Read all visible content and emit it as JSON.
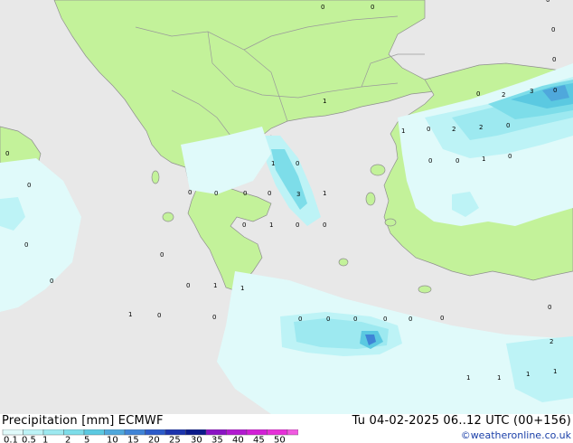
{
  "map": {
    "precip_numbers": [
      "0",
      "0",
      "0",
      "2",
      "3",
      "0",
      "0",
      "1",
      "0",
      "2",
      "2",
      "0",
      "0",
      "0",
      "1",
      "0",
      "0",
      "1",
      "0",
      "0",
      "1",
      "3",
      "0",
      "1",
      "0",
      "0",
      "0",
      "0",
      "0",
      "0",
      "1",
      "0",
      "0",
      "1",
      "1",
      "1",
      "0",
      "0",
      "0",
      "0",
      "0",
      "0",
      "2",
      "0",
      "1",
      "1",
      "1",
      "1",
      "0",
      "0",
      "0",
      "0",
      "0",
      "0"
    ]
  },
  "footer": {
    "title": "Precipitation [mm] ECMWF",
    "valid": "Tu 04-02-2025 06..12 UTC (00+156)",
    "credit": "©weatheronline.co.uk"
  },
  "legend": {
    "labels": [
      "0.1",
      "0.5",
      "1",
      "2",
      "5",
      "10",
      "15",
      "20",
      "25",
      "30",
      "35",
      "40",
      "45",
      "50"
    ],
    "colors": [
      "#e0fafa",
      "#bdf3f6",
      "#9de9f0",
      "#7ddde9",
      "#5bc9e1",
      "#4fa8dc",
      "#3f84d6",
      "#2c5bc9",
      "#1c34ad",
      "#0b1a8a",
      "#8a13c4",
      "#b21ad0",
      "#d21fd6",
      "#e62fd8",
      "#f05ae0"
    ]
  },
  "colors": {
    "land": "#c3f29a",
    "sea": "#e8e8e8",
    "border": "#9a9a9a"
  }
}
